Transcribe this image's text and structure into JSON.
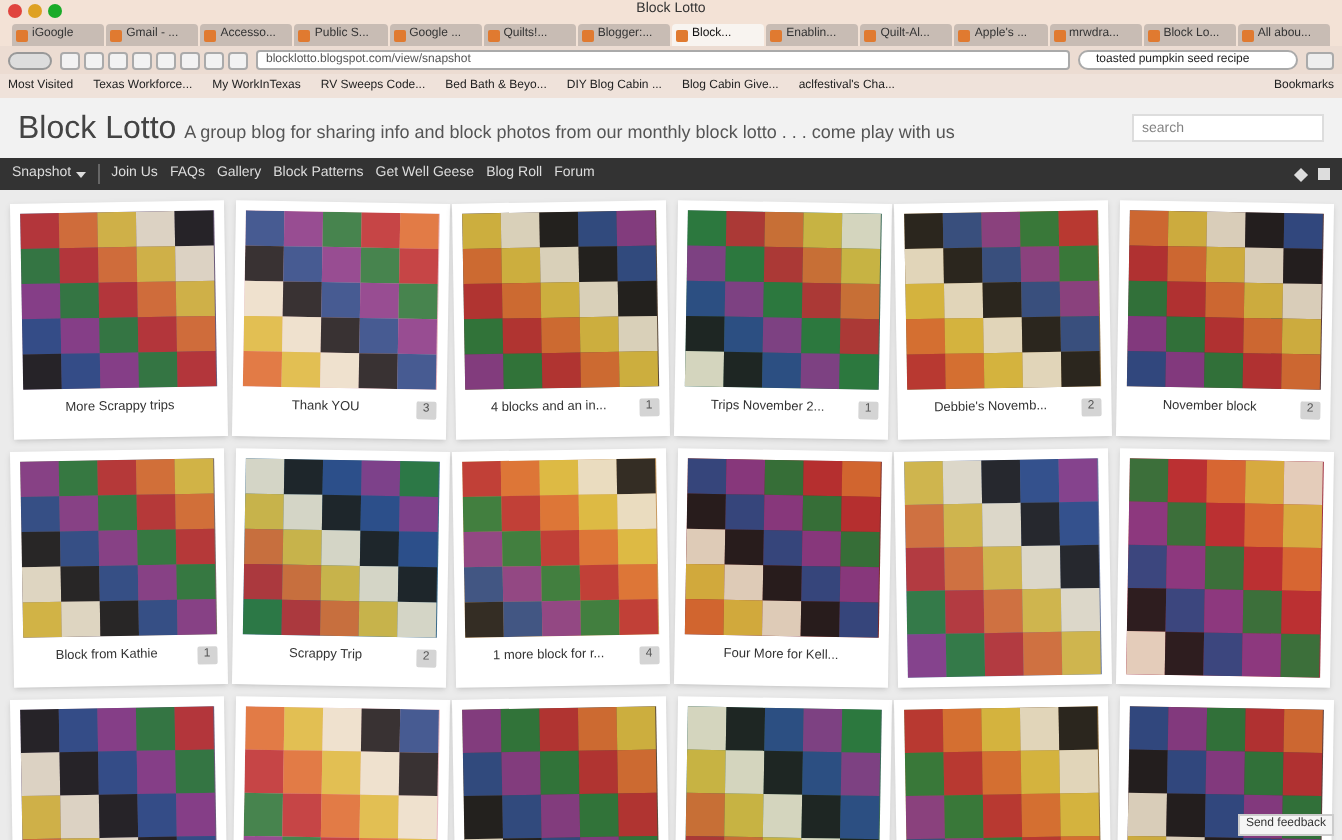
{
  "window": {
    "title": "Block Lotto"
  },
  "tabs": [
    {
      "label": "iGoogle",
      "selected": false
    },
    {
      "label": "Gmail - ...",
      "selected": false
    },
    {
      "label": "Accesso...",
      "selected": false
    },
    {
      "label": "Public S...",
      "selected": false
    },
    {
      "label": "Google ...",
      "selected": false
    },
    {
      "label": "Quilts!...",
      "selected": false
    },
    {
      "label": "Blogger:...",
      "selected": false
    },
    {
      "label": "Block...",
      "selected": true
    },
    {
      "label": "Enablin...",
      "selected": false
    },
    {
      "label": "Quilt-Al...",
      "selected": false
    },
    {
      "label": "Apple's ...",
      "selected": false
    },
    {
      "label": "mrwdra...",
      "selected": false
    },
    {
      "label": "Block Lo...",
      "selected": false
    },
    {
      "label": "All abou...",
      "selected": false
    }
  ],
  "address_bar": {
    "value": "blocklotto.blogspot.com/view/snapshot"
  },
  "browser_search": {
    "value": "toasted pumpkin seed recipe"
  },
  "bookmarks": [
    "Most Visited",
    "Texas Workforce...",
    "My WorkInTexas",
    "RV Sweeps Code...",
    "Bed Bath & Beyo...",
    "DIY Blog Cabin ...",
    "Blog Cabin Give...",
    "aclfestival's Cha..."
  ],
  "bookmarks_menu": "Bookmarks",
  "blog": {
    "title": "Block Lotto",
    "description": "A group blog for sharing info and block photos from our monthly block lotto . . . come play with us",
    "search": {
      "placeholder": "search"
    }
  },
  "nav": {
    "view_menu": "Snapshot",
    "links": [
      "Join Us",
      "FAQs",
      "Gallery",
      "Block Patterns",
      "Get Well Geese",
      "Blog Roll",
      "Forum"
    ]
  },
  "posts": [
    {
      "kind": "captioned",
      "caption": "More Scrappy trips"
    },
    {
      "kind": "captioned",
      "caption": "Thank YOU",
      "comments": "3"
    },
    {
      "kind": "captioned",
      "caption": "4 blocks and an in...",
      "comments": "1"
    },
    {
      "kind": "captioned",
      "caption": "Trips November 2...",
      "comments": "1"
    },
    {
      "kind": "captioned",
      "caption": "Debbie's Novemb...",
      "comments": "2"
    },
    {
      "kind": "captioned",
      "caption": "November block",
      "comments": "2"
    },
    {
      "kind": "captioned",
      "caption": "Block from Kathie",
      "comments": "1"
    },
    {
      "kind": "captioned",
      "caption": "Scrappy Trip",
      "comments": "2"
    },
    {
      "kind": "captioned",
      "caption": "1 more block for r...",
      "comments": "4"
    },
    {
      "kind": "captioned",
      "caption": "Four More for Kell..."
    },
    {
      "kind": "photo"
    },
    {
      "kind": "photo"
    },
    {
      "kind": "photo"
    },
    {
      "kind": "photo"
    },
    {
      "kind": "photo"
    },
    {
      "kind": "photo"
    },
    {
      "kind": "photo"
    },
    {
      "kind": "photo"
    }
  ],
  "feedback_button": "Send feedback"
}
